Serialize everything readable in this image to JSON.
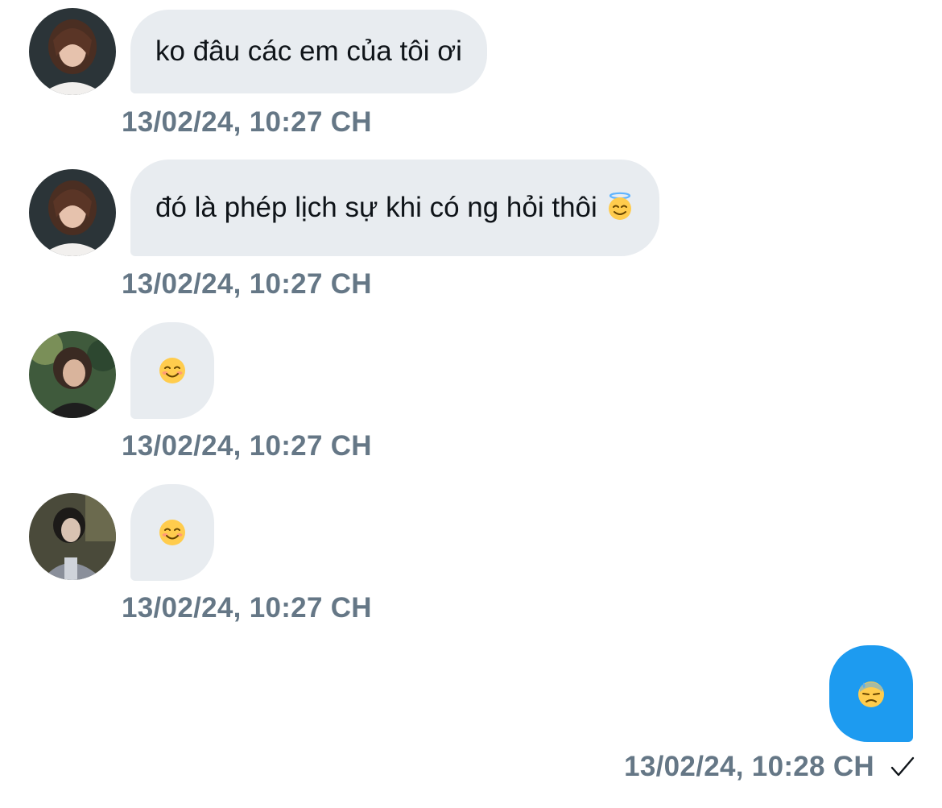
{
  "messages": [
    {
      "sender": "incoming",
      "text": "ko đâu các em của tôi ơi",
      "emoji": "",
      "time": "13/02/24, 10:27 CH"
    },
    {
      "sender": "incoming",
      "text": "đó là phép lịch sự khi có ng hỏi thôi",
      "emoji": "smiling-face-with-halo",
      "time": "13/02/24, 10:27 CH"
    },
    {
      "sender": "incoming",
      "text": "",
      "emoji": "smiling-face-with-smiling-eyes",
      "time": "13/02/24, 10:27 CH"
    },
    {
      "sender": "incoming",
      "text": "",
      "emoji": "smiling-face-with-smiling-eyes",
      "time": "13/02/24, 10:27 CH"
    },
    {
      "sender": "outgoing",
      "text": "",
      "emoji": "downcast-face-with-sweat",
      "time": "13/02/24, 10:28 CH",
      "status": "sent-check"
    }
  ],
  "colors": {
    "incoming_bubble": "#e8ecf0",
    "outgoing_bubble": "#1d9bf0",
    "timestamp": "#657786",
    "text": "#0f1419"
  }
}
